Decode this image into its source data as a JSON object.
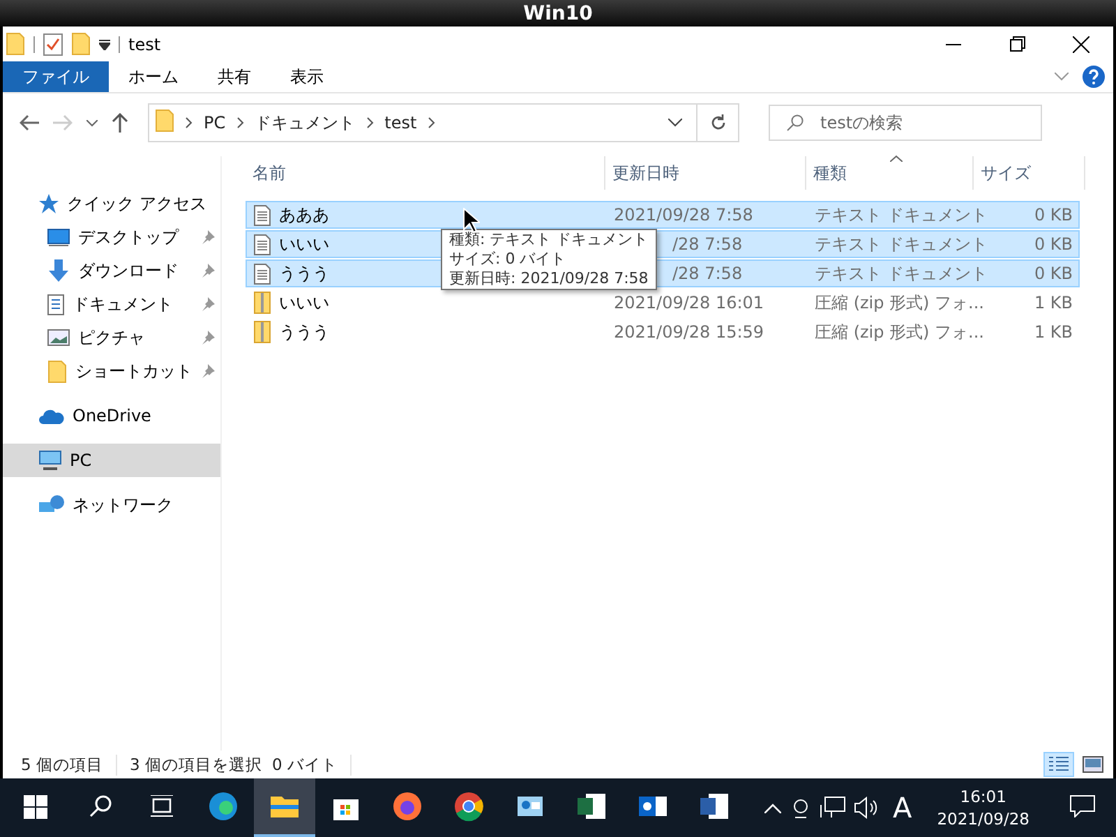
{
  "window": {
    "title": "Win10"
  },
  "quick_access_toolbar": {
    "folder_name": "test"
  },
  "ribbon": {
    "tabs": [
      {
        "label": "ファイル",
        "selected": true
      },
      {
        "label": "ホーム",
        "selected": false
      },
      {
        "label": "共有",
        "selected": false
      },
      {
        "label": "表示",
        "selected": false
      }
    ]
  },
  "address_bar": {
    "crumbs": [
      "PC",
      "ドキュメント",
      "test"
    ]
  },
  "search": {
    "placeholder": "testの検索"
  },
  "nav": {
    "items": [
      {
        "label": "クイック アクセス",
        "kind": "section",
        "selected": false
      },
      {
        "label": "デスクトップ",
        "kind": "pinned",
        "selected": false
      },
      {
        "label": "ダウンロード",
        "kind": "pinned",
        "selected": false
      },
      {
        "label": "ドキュメント",
        "kind": "pinned",
        "selected": false
      },
      {
        "label": "ピクチャ",
        "kind": "pinned",
        "selected": false
      },
      {
        "label": "ショートカット",
        "kind": "pinned",
        "selected": false
      },
      {
        "label": "OneDrive",
        "kind": "section",
        "selected": false
      },
      {
        "label": "PC",
        "kind": "section",
        "selected": true
      },
      {
        "label": "ネットワーク",
        "kind": "section",
        "selected": false
      }
    ]
  },
  "table": {
    "columns": [
      {
        "label": "名前",
        "sorted": false
      },
      {
        "label": "更新日時",
        "sorted": false
      },
      {
        "label": "種類",
        "sorted": true
      },
      {
        "label": "サイズ",
        "sorted": false
      }
    ],
    "rows": [
      {
        "name": "あああ",
        "date": "2021/09/28 7:58",
        "type": "テキスト ドキュメント",
        "size": "0 KB",
        "kind": "text",
        "selected": true
      },
      {
        "name": "いいい",
        "date": "/28 7:58",
        "type": "テキスト ドキュメント",
        "size": "0 KB",
        "kind": "text",
        "selected": true,
        "date_covered": true
      },
      {
        "name": "ううう",
        "date": "/28 7:58",
        "type": "テキスト ドキュメント",
        "size": "0 KB",
        "kind": "text",
        "selected": true,
        "date_covered": true
      },
      {
        "name": "いいい",
        "date": "2021/09/28 16:01",
        "type": "圧縮 (zip 形式) フォ...",
        "size": "1 KB",
        "kind": "zip",
        "selected": false
      },
      {
        "name": "ううう",
        "date": "2021/09/28 15:59",
        "type": "圧縮 (zip 形式) フォ...",
        "size": "1 KB",
        "kind": "zip",
        "selected": false
      }
    ]
  },
  "tooltip": {
    "lines": [
      "種類: テキスト ドキュメント",
      "サイズ: 0 バイト",
      "更新日時: 2021/09/28 7:58"
    ]
  },
  "status_bar": {
    "item_count": "5 個の項目",
    "selection": "3 個の項目を選択",
    "selection_size": "0 バイト",
    "views": [
      {
        "kind": "details",
        "selected": true
      },
      {
        "kind": "large_icons",
        "selected": false
      }
    ]
  },
  "taskbar": {
    "apps": [
      {
        "kind": "edge",
        "active": false
      },
      {
        "kind": "explorer",
        "active": true
      },
      {
        "kind": "store",
        "active": false
      },
      {
        "kind": "firefox",
        "active": false
      },
      {
        "kind": "chrome",
        "active": false
      },
      {
        "kind": "contacts",
        "active": false
      },
      {
        "kind": "excel",
        "active": false
      },
      {
        "kind": "outlook",
        "active": false
      },
      {
        "kind": "word",
        "active": false
      }
    ],
    "ime": "A",
    "time": "16:01",
    "date": "2021/09/28"
  }
}
